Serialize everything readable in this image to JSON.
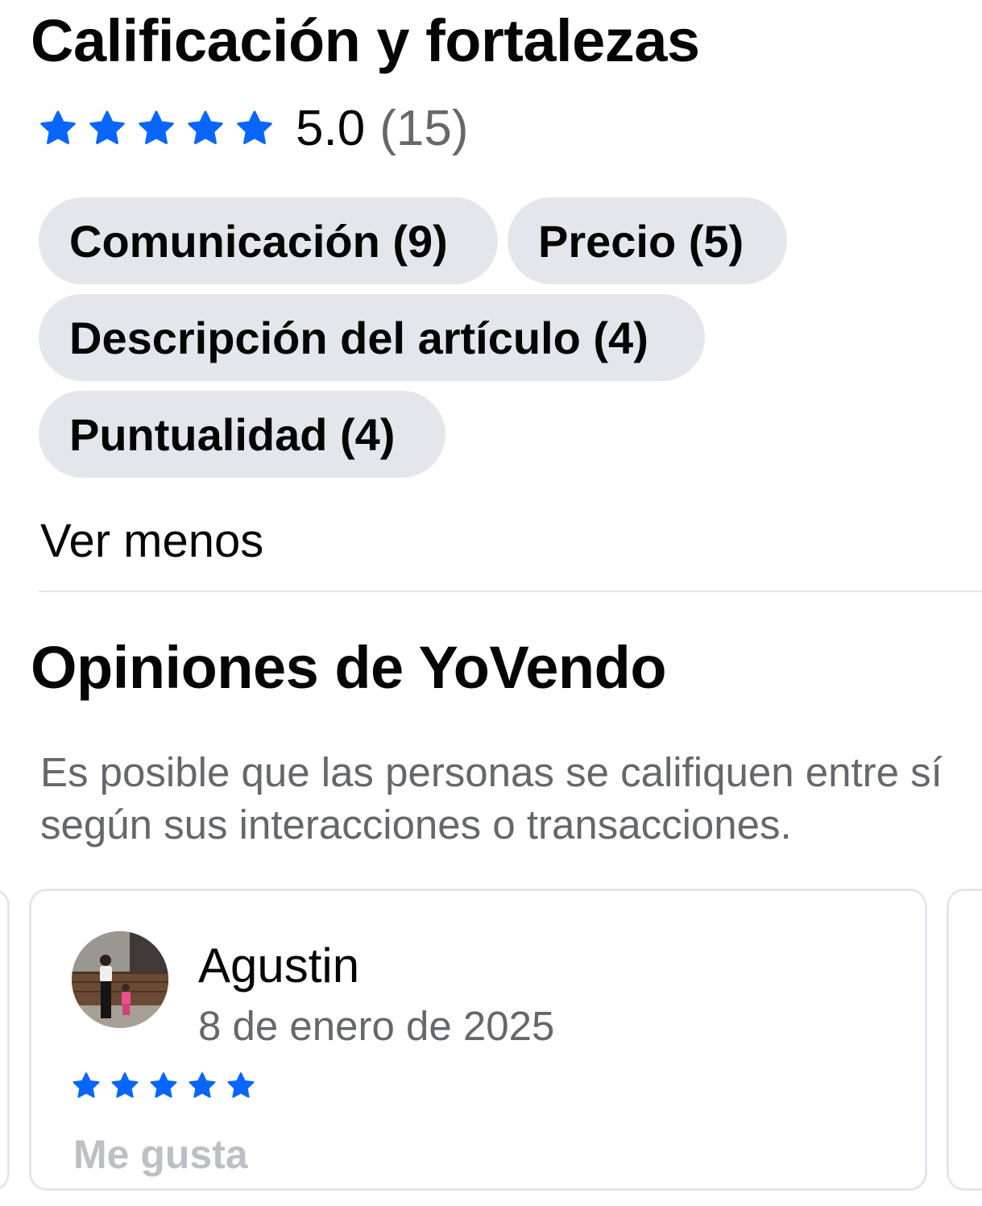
{
  "rating_section": {
    "title": "Calificación y fortalezas",
    "stars": 5,
    "rating": "5.0",
    "count": "(15)",
    "strengths": [
      {
        "label": "Comunicación (9)"
      },
      {
        "label": "Precio (5)"
      },
      {
        "label": "Descripción del artículo (4)"
      },
      {
        "label": "Puntualidad (4)"
      }
    ],
    "toggle_label": "Ver menos"
  },
  "reviews_section": {
    "title": "Opiniones de YoVendo",
    "description": "Es posible que las personas se califiquen entre sí según sus interacciones o transacciones.",
    "reviews": [
      {
        "name": "Agustin",
        "date": "8 de enero de 2025",
        "stars": 5,
        "like_label": "Me gusta"
      }
    ]
  },
  "colors": {
    "accent": "#0866ff",
    "chip_bg": "#e4e6eb",
    "secondary_text": "#65676b",
    "disabled_text": "#bcc0c4"
  },
  "icons": {
    "star": "star-icon",
    "avatar": "user-avatar"
  }
}
